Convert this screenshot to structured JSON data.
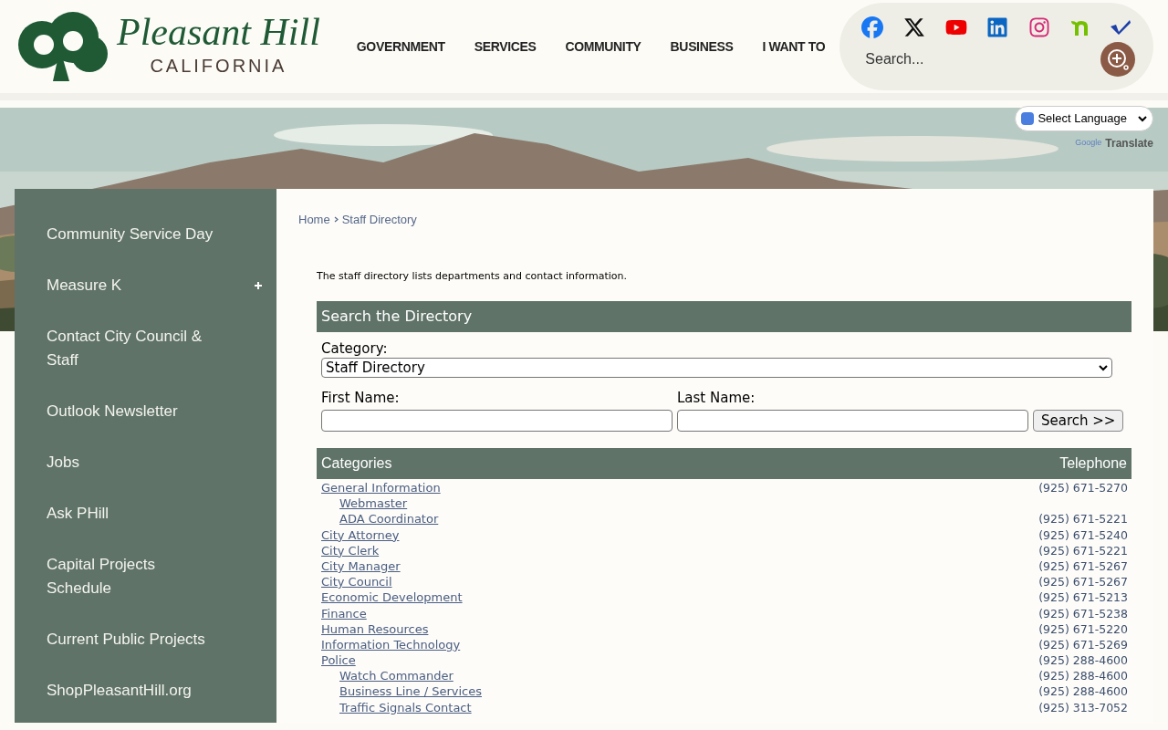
{
  "logo": {
    "title": "Pleasant Hill",
    "subtitle": "CALIFORNIA"
  },
  "nav": [
    "GOVERNMENT",
    "SERVICES",
    "COMMUNITY",
    "BUSINESS",
    "I WANT TO"
  ],
  "site_search": {
    "placeholder": "Search..."
  },
  "translate": {
    "select": "Select Language",
    "powered_by": "Google",
    "label": "Translate"
  },
  "sidebar": {
    "items": [
      {
        "label": "Community Service Day",
        "expandable": false
      },
      {
        "label": "Measure K",
        "expandable": true
      },
      {
        "label": "Contact City Council & Staff",
        "expandable": false
      },
      {
        "label": "Outlook Newsletter",
        "expandable": false
      },
      {
        "label": "Jobs",
        "expandable": false
      },
      {
        "label": "Ask PHill",
        "expandable": false
      },
      {
        "label": "Capital Projects Schedule",
        "expandable": false
      },
      {
        "label": "Current Public Projects",
        "expandable": false
      },
      {
        "label": "ShopPleasantHill.org",
        "expandable": false
      }
    ]
  },
  "breadcrumb": [
    "Home",
    "Staff Directory"
  ],
  "intro": "The staff directory lists departments and contact information.",
  "search_panel": {
    "title": "Search the Directory",
    "category_label": "Category:",
    "category_value": "Staff Directory",
    "first_name_label": "First Name:",
    "last_name_label": "Last Name:",
    "button": "Search >>"
  },
  "directory": {
    "columns": [
      "Categories",
      "Telephone"
    ],
    "rows": [
      {
        "name": "General Information",
        "phone": "(925) 671-5270",
        "children": [
          {
            "name": "Webmaster"
          },
          {
            "name": "ADA Coordinator",
            "phone": "(925) 671-5221"
          }
        ]
      },
      {
        "name": "City Attorney",
        "phone": "(925) 671-5240"
      },
      {
        "name": "City Clerk",
        "phone": "(925) 671-5221"
      },
      {
        "name": "City Manager",
        "phone": "(925) 671-5267"
      },
      {
        "name": "City Council",
        "phone": "(925) 671-5267"
      },
      {
        "name": "Economic Development",
        "phone": "(925) 671-5213"
      },
      {
        "name": "Finance",
        "phone": "(925) 671-5238"
      },
      {
        "name": "Human Resources",
        "phone": "(925) 671-5220"
      },
      {
        "name": "Information Technology",
        "phone": "(925) 671-5269"
      },
      {
        "name": "Police",
        "phone": "(925) 288-4600",
        "children": [
          {
            "name": "Watch Commander",
            "phone": "(925) 288-4600"
          },
          {
            "name": "Business Line / Services",
            "phone": "(925) 288-4600"
          },
          {
            "name": "Traffic Signals Contact",
            "phone": "(925) 313-7052"
          }
        ]
      }
    ]
  }
}
